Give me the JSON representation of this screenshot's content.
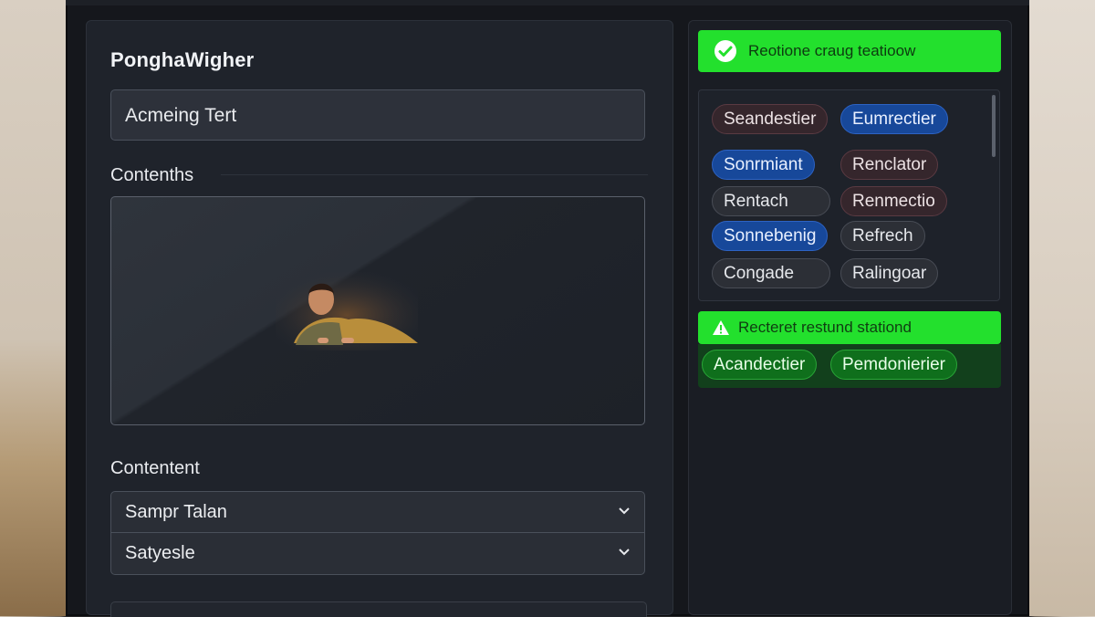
{
  "panel": {
    "title": "PonghaWigher",
    "input_value": "Acmeing Tert",
    "section_contents": "Contenths",
    "section_content": "Contentent",
    "select_1": "Sampr Talan",
    "select_2": "Satyesle"
  },
  "right": {
    "success_banner": "Reotione craug teatioow",
    "chips": [
      {
        "label": "Seandestier",
        "style": "maroon"
      },
      {
        "label": "Eumrectier",
        "style": "blue"
      },
      {
        "label": "Sonrmiant",
        "style": "blue"
      },
      {
        "label": "Renclator",
        "style": "maroon"
      },
      {
        "label": "Rentach",
        "style": "grey"
      },
      {
        "label": "Renmectio",
        "style": "maroon"
      },
      {
        "label": "Sonnebenig",
        "style": "blue"
      },
      {
        "label": "Refrech",
        "style": "grey"
      },
      {
        "label": "Congade",
        "style": "grey"
      },
      {
        "label": "Ralingoar",
        "style": "grey"
      }
    ],
    "warning_banner": "Recteret restund stationd",
    "green_chips": [
      "Acandectier",
      "Pemdonierier"
    ]
  },
  "colors": {
    "accent_green": "#23e02d",
    "chip_blue": "#17489a",
    "panel_bg": "#1f232b"
  },
  "icons": [
    "check-circle-icon",
    "warning-icon",
    "chevron-down-icon"
  ]
}
